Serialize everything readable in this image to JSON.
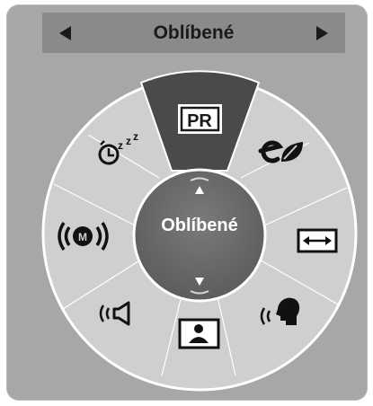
{
  "header": {
    "title": "Oblíbené",
    "prev_icon": "triangle-left-icon",
    "next_icon": "triangle-right-icon"
  },
  "wheel": {
    "center_label": "Oblíbené",
    "selected_segment": "PR",
    "items": [
      {
        "id": "pr",
        "icon": "pr-icon",
        "glyph": "PR"
      },
      {
        "id": "energy",
        "icon": "energy-saving-icon"
      },
      {
        "id": "aspect",
        "icon": "aspect-ratio-icon"
      },
      {
        "id": "voice",
        "icon": "clear-voice-icon"
      },
      {
        "id": "picture",
        "icon": "picture-mode-icon"
      },
      {
        "id": "sound",
        "icon": "sound-mode-icon"
      },
      {
        "id": "audio",
        "icon": "audio-m-icon",
        "glyph": "M"
      },
      {
        "id": "sleep",
        "icon": "sleep-timer-icon",
        "glyph": "z"
      }
    ]
  },
  "colors": {
    "panel": "#a7a7a7",
    "wheel": "#cfcfcf",
    "selected": "#4a4a4a",
    "center": "#6d6d6d"
  }
}
